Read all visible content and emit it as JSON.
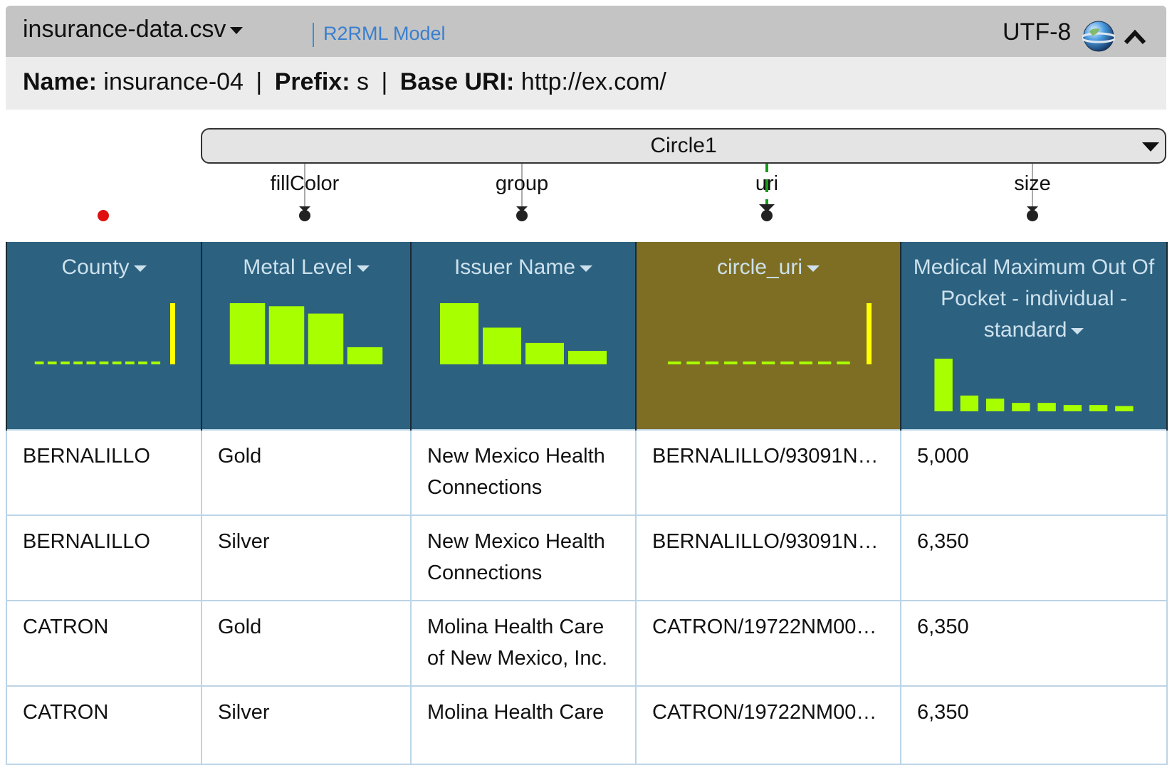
{
  "header": {
    "filename": "insurance-data.csv",
    "model_link": "R2RML Model",
    "encoding": "UTF-8",
    "globe_icon": "globe-icon",
    "collapse_icon": "chevron-up-icon"
  },
  "info": {
    "name_label": "Name:",
    "name_value": "insurance-04",
    "prefix_label": "Prefix:",
    "prefix_value": "s",
    "base_label": "Base URI:",
    "base_value": "http://ex.com/"
  },
  "model": {
    "class_name": "Circle1",
    "properties": [
      "fillColor",
      "group",
      "uri",
      "size"
    ],
    "colors": {
      "uri_link": "#1a9a1a",
      "unmapped_dot": "#e01010"
    }
  },
  "table": {
    "columns": [
      {
        "label": "County",
        "selected": false,
        "histogram": {
          "color_main": "#a8ff00",
          "color_last": "#ffff00",
          "values": [
            2,
            2,
            2,
            2,
            2,
            2,
            2,
            2,
            2,
            2,
            100
          ]
        }
      },
      {
        "label": "Metal Level",
        "selected": false,
        "histogram": {
          "color_main": "#a8ff00",
          "color_last": "#a8ff00",
          "values": [
            100,
            95,
            83,
            28
          ]
        }
      },
      {
        "label": "Issuer Name",
        "selected": false,
        "histogram": {
          "color_main": "#a8ff00",
          "color_last": "#a8ff00",
          "values": [
            100,
            60,
            35,
            22
          ]
        }
      },
      {
        "label": "circle_uri",
        "selected": true,
        "histogram": {
          "color_main": "#a8ff00",
          "color_last": "#ffff00",
          "values": [
            3,
            3,
            3,
            3,
            3,
            3,
            3,
            3,
            3,
            3,
            100
          ]
        }
      },
      {
        "label": "Medical Maximum Out Of Pocket - individual - standard",
        "selected": false,
        "histogram": {
          "color_main": "#a8ff00",
          "color_last": "#a8ff00",
          "values": [
            100,
            30,
            24,
            16,
            16,
            12,
            12,
            10
          ]
        }
      }
    ],
    "rows": [
      [
        "BERNALILLO",
        "Gold",
        "New Mexico Health Connections",
        "BERNALILLO/93091N…",
        "5,000"
      ],
      [
        "BERNALILLO",
        "Silver",
        "New Mexico Health Connections",
        "BERNALILLO/93091N…",
        "6,350"
      ],
      [
        "CATRON",
        "Gold",
        "Molina Health Care of New Mexico, Inc.",
        "CATRON/19722NM00…",
        "6,350"
      ],
      [
        "CATRON",
        "Silver",
        "Molina Health Care",
        "CATRON/19722NM00…",
        "6,350"
      ]
    ]
  }
}
